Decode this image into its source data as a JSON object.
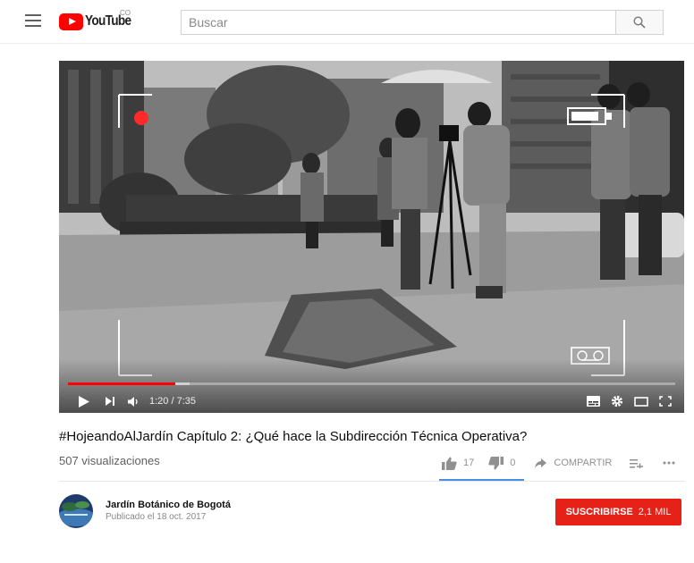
{
  "header": {
    "logo_text": "YouTube",
    "country_code": "CO",
    "search_placeholder": "Buscar"
  },
  "player": {
    "current_time": "1:20",
    "duration": "7:35",
    "time_display": "1:20 / 7:35",
    "played_fraction": 0.176,
    "buffered_fraction": 0.2
  },
  "video": {
    "title": "#HojeandoAlJardín Capítulo 2: ¿Qué hace la Subdirección Técnica Operativa?",
    "views": "507 visualizaciones",
    "likes": "17",
    "dislikes": "0",
    "share_label": "COMPARTIR"
  },
  "channel": {
    "name": "Jardín Botánico de Bogotá",
    "published": "Publicado el 18 oct. 2017",
    "subscribe_label": "SUSCRIBIRSE",
    "subscriber_count": "2,1 MIL"
  },
  "colors": {
    "brand_red": "#ff0000",
    "subscribe_red": "#e62117",
    "like_accent": "#4a90e2"
  },
  "icons": [
    "menu-icon",
    "youtube-logo-icon",
    "search-icon",
    "play-icon",
    "next-icon",
    "volume-icon",
    "subtitles-icon",
    "settings-icon",
    "theater-icon",
    "fullscreen-icon",
    "thumbs-up-icon",
    "thumbs-down-icon",
    "share-icon",
    "add-to-playlist-icon",
    "more-icon",
    "record-icon",
    "battery-icon",
    "cassette-icon"
  ]
}
